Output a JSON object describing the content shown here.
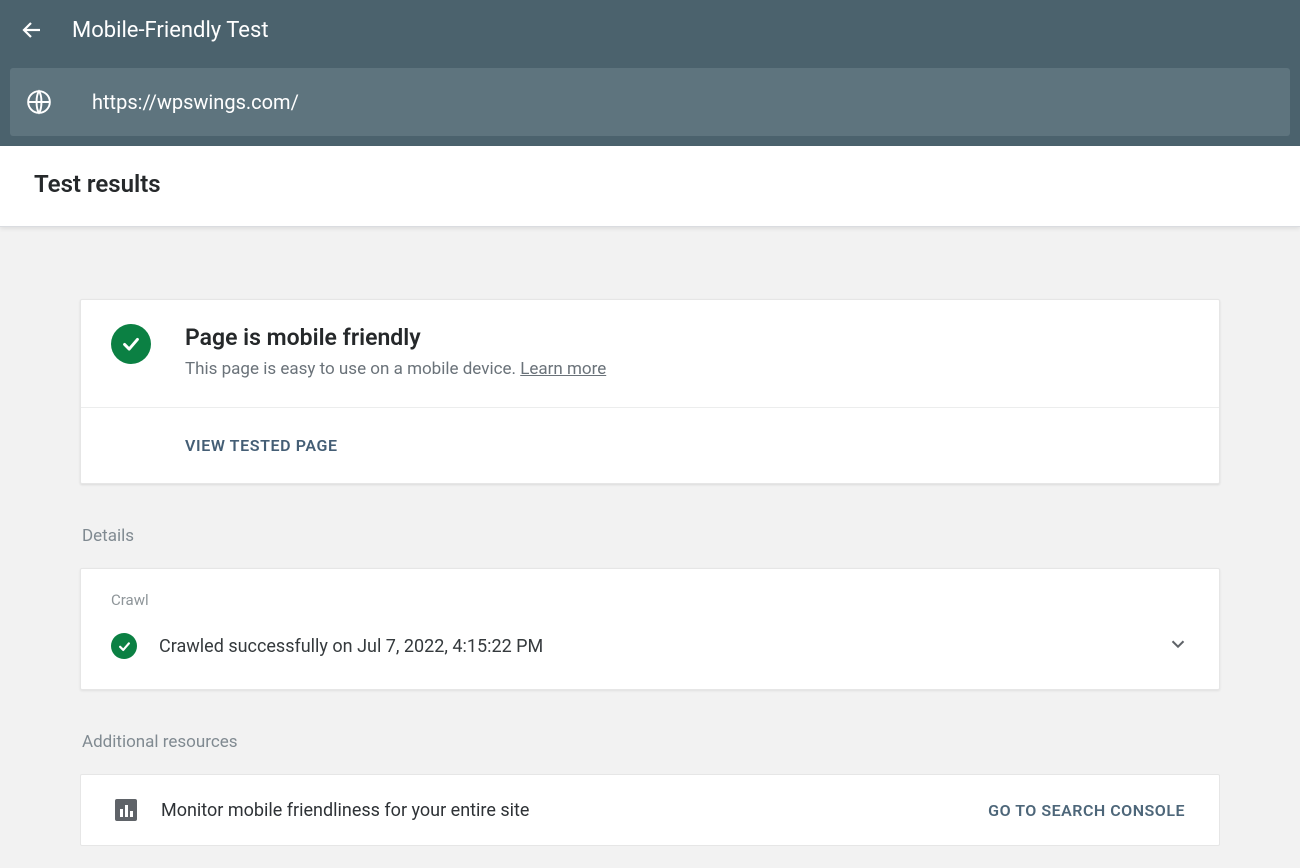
{
  "header": {
    "title": "Mobile-Friendly Test"
  },
  "url": "https://wpswings.com/",
  "tab": {
    "title": "Test results"
  },
  "result": {
    "title": "Page is mobile friendly",
    "description": "This page is easy to use on a mobile device. ",
    "learn_more": "Learn more",
    "view_tested": "VIEW TESTED PAGE"
  },
  "details": {
    "section_label": "Details",
    "crawl_label": "Crawl",
    "crawl_status": "Crawled successfully on Jul 7, 2022, 4:15:22 PM"
  },
  "resources": {
    "section_label": "Additional resources",
    "description": "Monitor mobile friendliness for your entire site",
    "console_link": "GO TO SEARCH CONSOLE"
  }
}
